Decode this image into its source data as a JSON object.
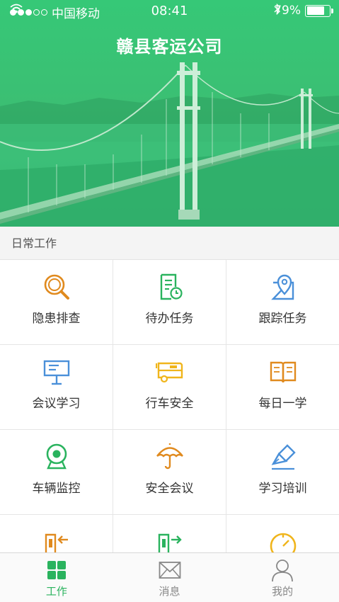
{
  "status_bar": {
    "carrier": "中国移动",
    "time": "08:41",
    "battery": "79%",
    "battery_level": 0.79
  },
  "header": {
    "title": "赣县客运公司"
  },
  "section": {
    "title": "日常工作"
  },
  "grid": {
    "items": [
      {
        "label": "隐患排查",
        "icon": "magnifier-icon",
        "color": "#e08a1e"
      },
      {
        "label": "待办任务",
        "icon": "task-list-clock-icon",
        "color": "#2ab35e"
      },
      {
        "label": "跟踪任务",
        "icon": "map-pin-icon",
        "color": "#4a90d9"
      },
      {
        "label": "会议学习",
        "icon": "presentation-board-icon",
        "color": "#4a90d9"
      },
      {
        "label": "行车安全",
        "icon": "bus-icon",
        "color": "#f0b51c"
      },
      {
        "label": "每日一学",
        "icon": "open-book-icon",
        "color": "#e08a1e"
      },
      {
        "label": "车辆监控",
        "icon": "webcam-icon",
        "color": "#2ab35e"
      },
      {
        "label": "安全会议",
        "icon": "umbrella-icon",
        "color": "#e08a1e"
      },
      {
        "label": "学习培训",
        "icon": "pen-nib-icon",
        "color": "#4a90d9"
      },
      {
        "label": "",
        "icon": "check-in-icon",
        "color": "#e08a1e"
      },
      {
        "label": "",
        "icon": "check-out-icon",
        "color": "#2ab35e"
      },
      {
        "label": "",
        "icon": "clock-icon",
        "color": "#f0b51c"
      }
    ]
  },
  "tabbar": {
    "items": [
      {
        "label": "工作",
        "icon": "grid-icon",
        "active": true
      },
      {
        "label": "消息",
        "icon": "envelope-icon",
        "active": false
      },
      {
        "label": "我的",
        "icon": "person-icon",
        "active": false
      }
    ]
  },
  "colors": {
    "brand": "#2ab35e",
    "hero": "#36c877"
  }
}
